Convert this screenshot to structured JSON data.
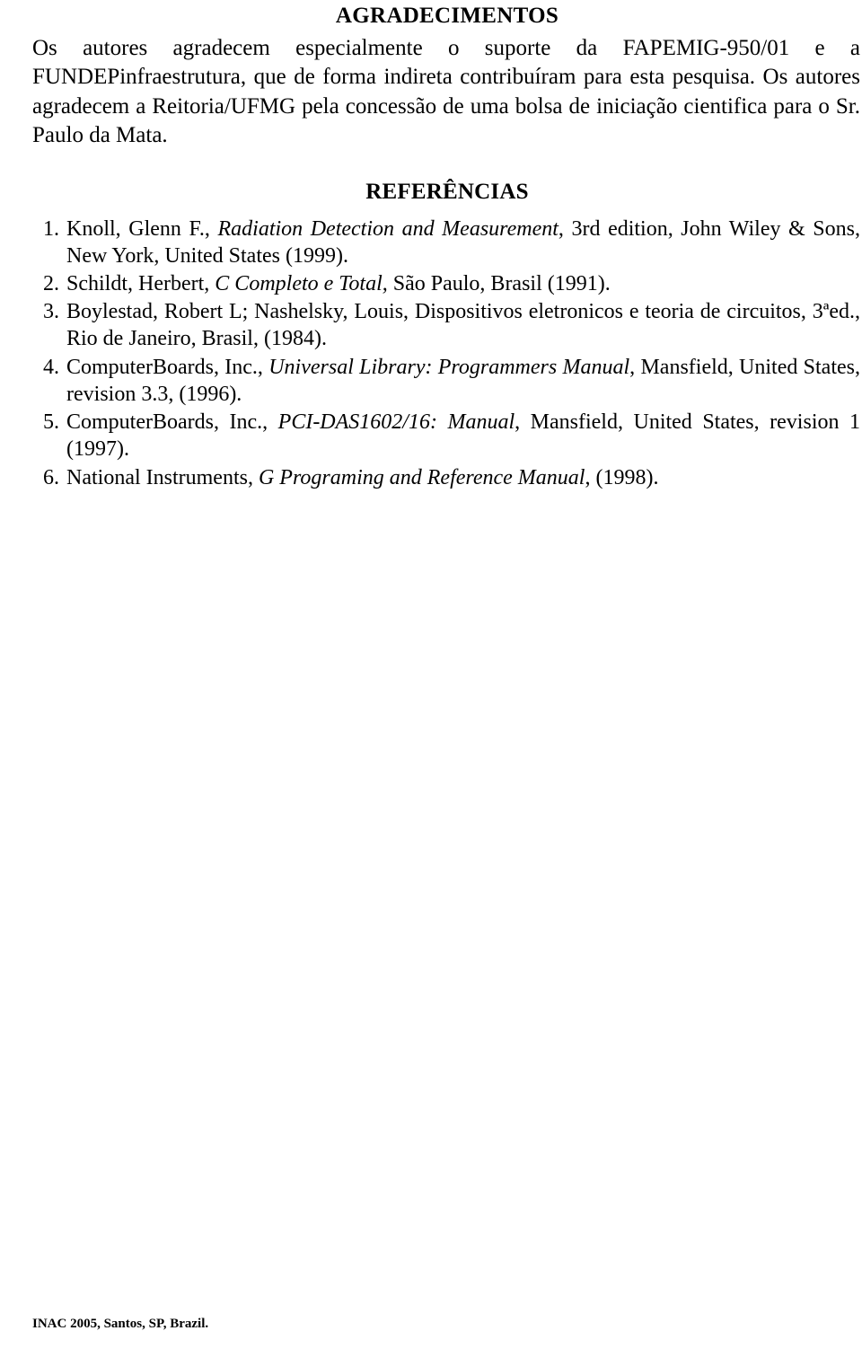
{
  "sections": {
    "acknowledgements_title": "AGRADECIMENTOS",
    "references_title": "REFERÊNCIAS"
  },
  "acknowledgement": {
    "text": "Os autores agradecem especialmente o suporte da FAPEMIG-950/01 e a FUNDEPinfraestrutura, que de forma indireta contribuíram para esta pesquisa. Os autores agradecem a Reitoria/UFMG pela concessão de uma bolsa de iniciação cientifica para o Sr. Paulo da Mata."
  },
  "references": [
    {
      "number": "1.",
      "pre": "Knoll, Glenn F., ",
      "italic": "Radiation Detection and Measurement",
      "post": ", 3rd edition, John Wiley & Sons, New York, United States (1999)."
    },
    {
      "number": "2.",
      "pre": "Schildt, Herbert, ",
      "italic": "C Completo e Total,",
      "post": " São Paulo, Brasil (1991)."
    },
    {
      "number": "3.",
      "pre": "Boylestad, Robert L; Nashelsky, Louis, Dispositivos eletronicos e teoria de circuitos, 3ªed., Rio de Janeiro, Brasil, (1984).",
      "italic": "",
      "post": ""
    },
    {
      "number": "4.",
      "pre": "ComputerBoards, Inc., ",
      "italic": "Universal Library: Programmers Manual",
      "post": ", Mansfield, United States, revision 3.3, (1996)."
    },
    {
      "number": "5.",
      "pre": "ComputerBoards, Inc., ",
      "italic": "PCI-DAS1602/16: Manual",
      "post": ", Mansfield, United States, revision 1 (1997)."
    },
    {
      "number": "6.",
      "pre": "National Instruments, ",
      "italic": "G Programing and Reference Manual",
      "post": ", (1998)."
    }
  ],
  "footer": {
    "text": "INAC 2005, Santos, SP, Brazil."
  }
}
